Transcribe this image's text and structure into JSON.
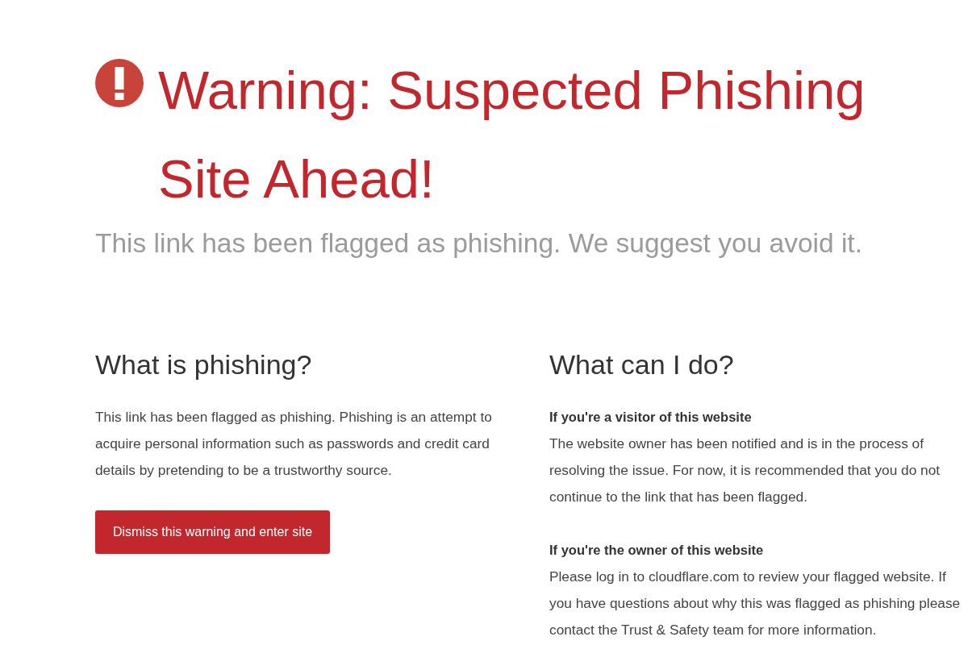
{
  "header": {
    "title": "Warning: Suspected Phishing Site Ahead!",
    "subtitle": "This link has been flagged as phishing. We suggest you avoid it."
  },
  "sections": [
    {
      "heading": "What is phishing?",
      "blocks": [
        {
          "kind": "paragraph",
          "text": "This link has been flagged as phishing. Phishing is an attempt to acquire personal information such as passwords and credit card details by pretending to be a trustworthy source."
        },
        {
          "kind": "button",
          "label": "Dismiss this warning and enter site"
        }
      ]
    },
    {
      "heading": "What can I do?",
      "blocks": [
        {
          "kind": "note",
          "title": "If you're a visitor of this website",
          "text": "The website owner has been notified and is in the process of resolving the issue. For now, it is recommended that you do not continue to the link that has been flagged."
        },
        {
          "kind": "note",
          "title": "If you're the owner of this website",
          "text": "Please log in to cloudflare.com to review your flagged website. If you have questions about why this was flagged as phishing please contact the Trust & Safety team for more information."
        }
      ]
    }
  ]
}
